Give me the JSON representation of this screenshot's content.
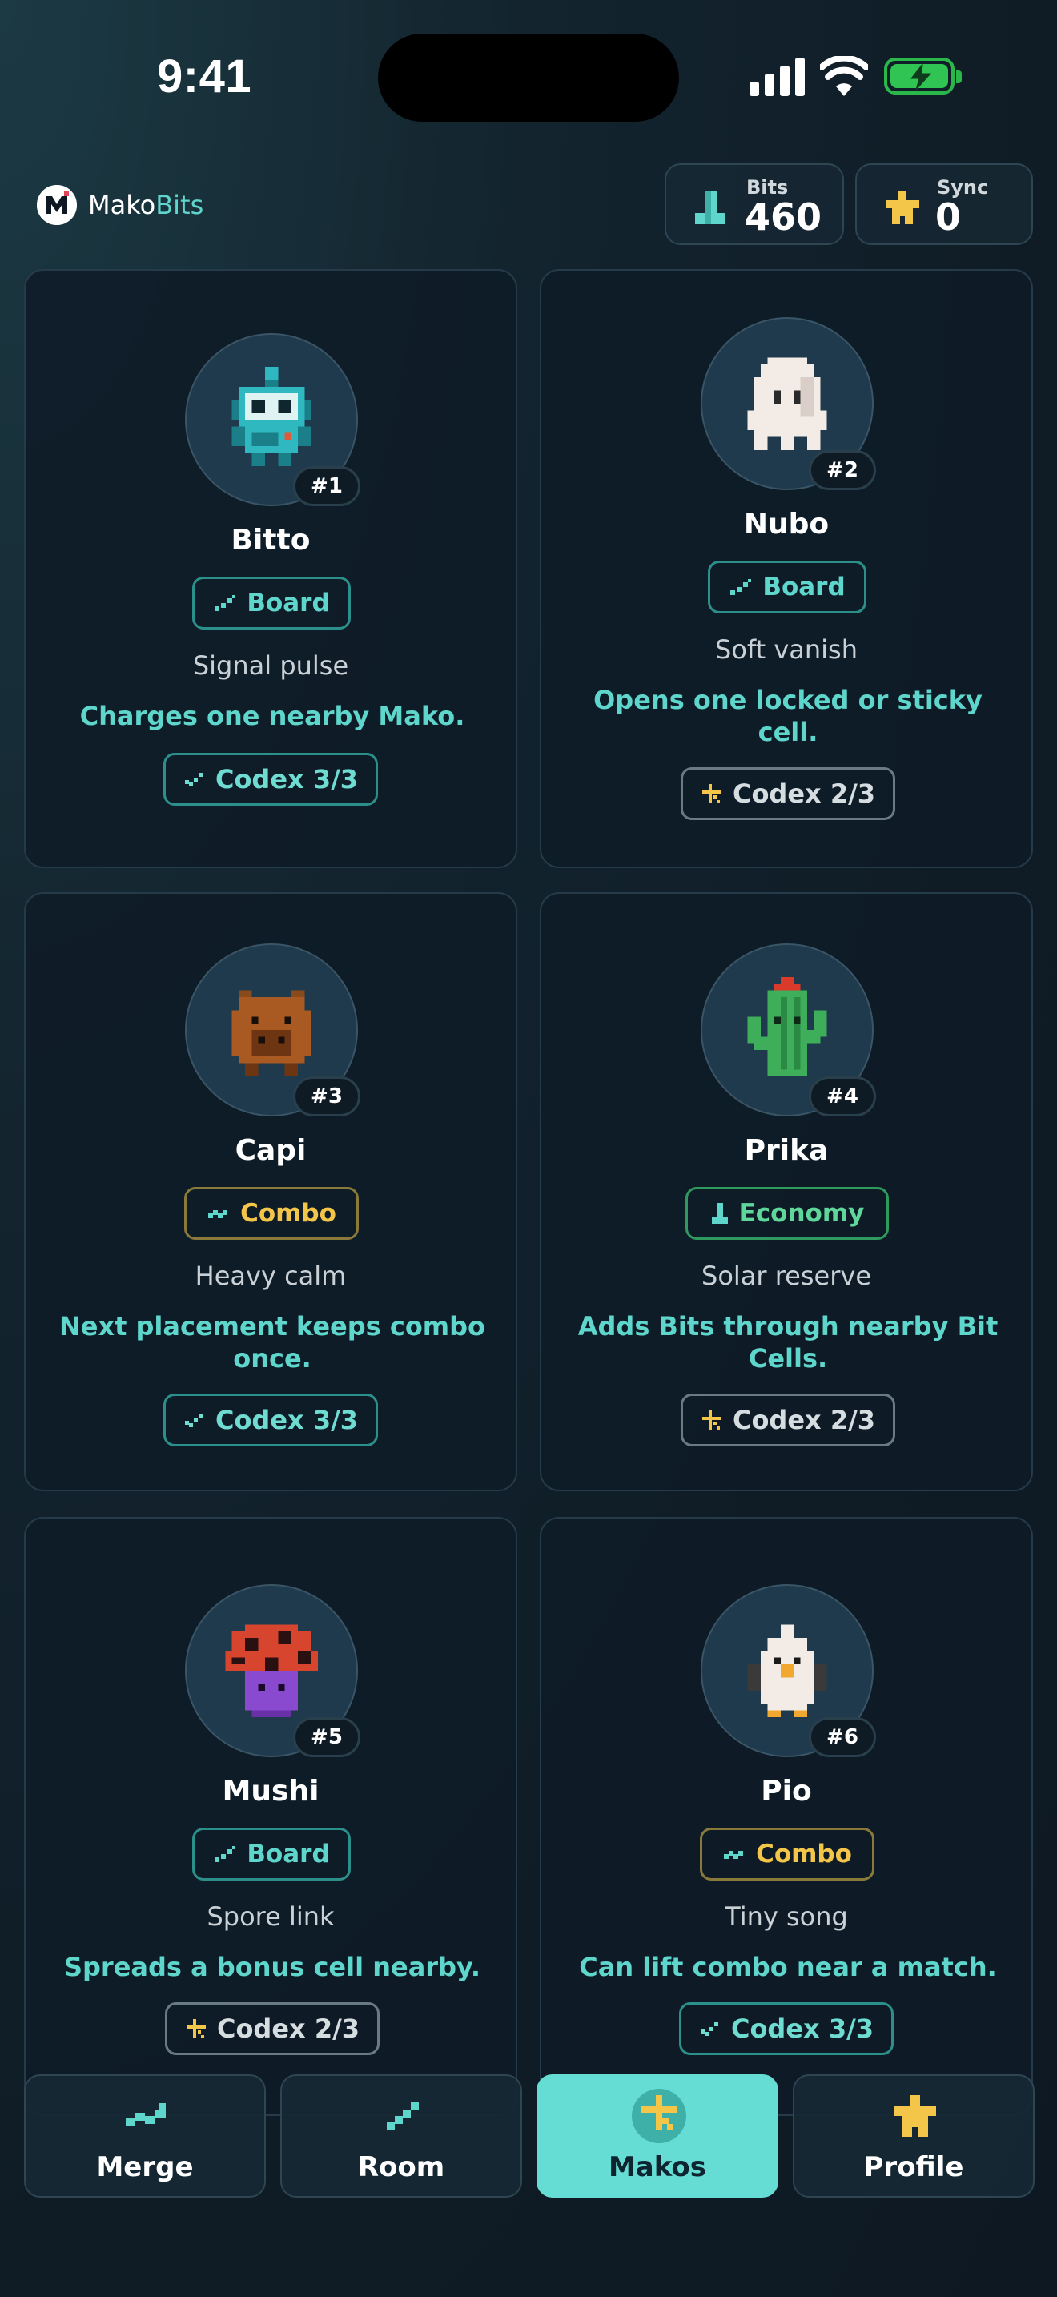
{
  "status_bar": {
    "time": "9:41"
  },
  "header": {
    "brand_part1": "Mako",
    "brand_part2": "Bits",
    "bits_label": "Bits",
    "bits_value": "460",
    "sync_label": "Sync",
    "sync_value": "0"
  },
  "makos": [
    {
      "number": "#1",
      "name": "Bitto",
      "tag": "Board",
      "flavor": "Signal pulse",
      "effect": "Charges one nearby Mako.",
      "codex": "Codex 3/3",
      "sprite": "robot-sprite"
    },
    {
      "number": "#2",
      "name": "Nubo",
      "tag": "Board",
      "flavor": "Soft vanish",
      "effect": "Opens one locked or sticky cell.",
      "codex": "Codex 2/3",
      "sprite": "ghost-sprite"
    },
    {
      "number": "#3",
      "name": "Capi",
      "tag": "Combo",
      "flavor": "Heavy calm",
      "effect": "Next placement keeps combo once.",
      "codex": "Codex 3/3",
      "sprite": "capybara-sprite"
    },
    {
      "number": "#4",
      "name": "Prika",
      "tag": "Economy",
      "flavor": "Solar reserve",
      "effect": "Adds Bits through nearby Bit Cells.",
      "codex": "Codex 2/3",
      "sprite": "cactus-sprite"
    },
    {
      "number": "#5",
      "name": "Mushi",
      "tag": "Board",
      "flavor": "Spore link",
      "effect": "Spreads a bonus cell nearby.",
      "codex": "Codex 2/3",
      "sprite": "mushroom-sprite"
    },
    {
      "number": "#6",
      "name": "Pio",
      "tag": "Combo",
      "flavor": "Tiny song",
      "effect": "Can lift combo near a match.",
      "codex": "Codex 3/3",
      "sprite": "chick-sprite"
    }
  ],
  "tabs": [
    {
      "label": "Merge",
      "icon": "merge-icon"
    },
    {
      "label": "Room",
      "icon": "room-icon"
    },
    {
      "label": "Makos",
      "icon": "makos-icon",
      "active": true
    },
    {
      "label": "Profile",
      "icon": "profile-icon"
    }
  ],
  "colors": {
    "accent": "#5fd6cc",
    "combo": "#f3c64a",
    "economy": "#5fd69a",
    "background": "#0f1c26"
  }
}
